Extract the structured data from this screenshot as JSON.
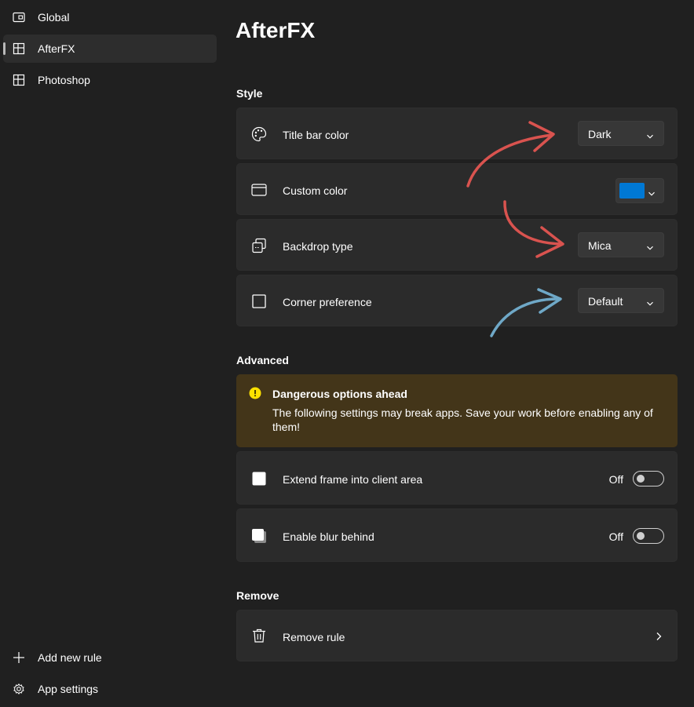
{
  "sidebar": {
    "items": [
      {
        "label": "Global",
        "icon": "window-icon",
        "selected": false
      },
      {
        "label": "AfterFX",
        "icon": "layout-icon",
        "selected": true
      },
      {
        "label": "Photoshop",
        "icon": "layout-icon",
        "selected": false
      }
    ],
    "footer": [
      {
        "label": "Add new rule",
        "icon": "plus-icon"
      },
      {
        "label": "App settings",
        "icon": "gear-icon"
      }
    ]
  },
  "page": {
    "title": "AfterFX"
  },
  "style": {
    "heading": "Style",
    "title_bar_color": {
      "label": "Title bar color",
      "value": "Dark"
    },
    "custom_color": {
      "label": "Custom color",
      "swatch": "#0078d4"
    },
    "backdrop_type": {
      "label": "Backdrop type",
      "value": "Mica"
    },
    "corner_preference": {
      "label": "Corner preference",
      "value": "Default"
    }
  },
  "advanced": {
    "heading": "Advanced",
    "warning": {
      "title": "Dangerous options ahead",
      "body": "The following settings may break apps. Save your work before enabling any of them!"
    },
    "extend_frame": {
      "label": "Extend frame into client area",
      "state": "Off"
    },
    "blur_behind": {
      "label": "Enable blur behind",
      "state": "Off"
    }
  },
  "remove": {
    "heading": "Remove",
    "label": "Remove rule"
  },
  "colors": {
    "background": "#202020",
    "card": "#2b2b2b",
    "warning_bg": "#433519",
    "warning_icon": "#fce100",
    "annotation_red": "#d9534f",
    "annotation_blue": "#6fa8c7"
  }
}
